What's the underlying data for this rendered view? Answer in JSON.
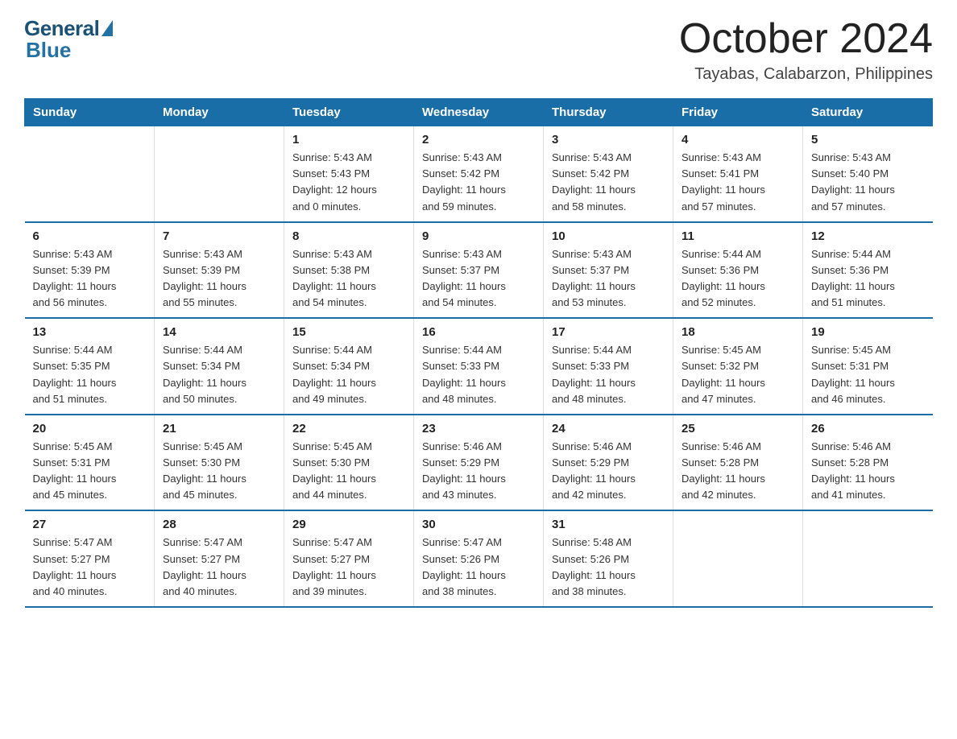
{
  "header": {
    "logo_general": "General",
    "logo_blue": "Blue",
    "month_title": "October 2024",
    "location": "Tayabas, Calabarzon, Philippines"
  },
  "weekdays": [
    "Sunday",
    "Monday",
    "Tuesday",
    "Wednesday",
    "Thursday",
    "Friday",
    "Saturday"
  ],
  "weeks": [
    [
      {
        "day": "",
        "info": ""
      },
      {
        "day": "",
        "info": ""
      },
      {
        "day": "1",
        "info": "Sunrise: 5:43 AM\nSunset: 5:43 PM\nDaylight: 12 hours\nand 0 minutes."
      },
      {
        "day": "2",
        "info": "Sunrise: 5:43 AM\nSunset: 5:42 PM\nDaylight: 11 hours\nand 59 minutes."
      },
      {
        "day": "3",
        "info": "Sunrise: 5:43 AM\nSunset: 5:42 PM\nDaylight: 11 hours\nand 58 minutes."
      },
      {
        "day": "4",
        "info": "Sunrise: 5:43 AM\nSunset: 5:41 PM\nDaylight: 11 hours\nand 57 minutes."
      },
      {
        "day": "5",
        "info": "Sunrise: 5:43 AM\nSunset: 5:40 PM\nDaylight: 11 hours\nand 57 minutes."
      }
    ],
    [
      {
        "day": "6",
        "info": "Sunrise: 5:43 AM\nSunset: 5:39 PM\nDaylight: 11 hours\nand 56 minutes."
      },
      {
        "day": "7",
        "info": "Sunrise: 5:43 AM\nSunset: 5:39 PM\nDaylight: 11 hours\nand 55 minutes."
      },
      {
        "day": "8",
        "info": "Sunrise: 5:43 AM\nSunset: 5:38 PM\nDaylight: 11 hours\nand 54 minutes."
      },
      {
        "day": "9",
        "info": "Sunrise: 5:43 AM\nSunset: 5:37 PM\nDaylight: 11 hours\nand 54 minutes."
      },
      {
        "day": "10",
        "info": "Sunrise: 5:43 AM\nSunset: 5:37 PM\nDaylight: 11 hours\nand 53 minutes."
      },
      {
        "day": "11",
        "info": "Sunrise: 5:44 AM\nSunset: 5:36 PM\nDaylight: 11 hours\nand 52 minutes."
      },
      {
        "day": "12",
        "info": "Sunrise: 5:44 AM\nSunset: 5:36 PM\nDaylight: 11 hours\nand 51 minutes."
      }
    ],
    [
      {
        "day": "13",
        "info": "Sunrise: 5:44 AM\nSunset: 5:35 PM\nDaylight: 11 hours\nand 51 minutes."
      },
      {
        "day": "14",
        "info": "Sunrise: 5:44 AM\nSunset: 5:34 PM\nDaylight: 11 hours\nand 50 minutes."
      },
      {
        "day": "15",
        "info": "Sunrise: 5:44 AM\nSunset: 5:34 PM\nDaylight: 11 hours\nand 49 minutes."
      },
      {
        "day": "16",
        "info": "Sunrise: 5:44 AM\nSunset: 5:33 PM\nDaylight: 11 hours\nand 48 minutes."
      },
      {
        "day": "17",
        "info": "Sunrise: 5:44 AM\nSunset: 5:33 PM\nDaylight: 11 hours\nand 48 minutes."
      },
      {
        "day": "18",
        "info": "Sunrise: 5:45 AM\nSunset: 5:32 PM\nDaylight: 11 hours\nand 47 minutes."
      },
      {
        "day": "19",
        "info": "Sunrise: 5:45 AM\nSunset: 5:31 PM\nDaylight: 11 hours\nand 46 minutes."
      }
    ],
    [
      {
        "day": "20",
        "info": "Sunrise: 5:45 AM\nSunset: 5:31 PM\nDaylight: 11 hours\nand 45 minutes."
      },
      {
        "day": "21",
        "info": "Sunrise: 5:45 AM\nSunset: 5:30 PM\nDaylight: 11 hours\nand 45 minutes."
      },
      {
        "day": "22",
        "info": "Sunrise: 5:45 AM\nSunset: 5:30 PM\nDaylight: 11 hours\nand 44 minutes."
      },
      {
        "day": "23",
        "info": "Sunrise: 5:46 AM\nSunset: 5:29 PM\nDaylight: 11 hours\nand 43 minutes."
      },
      {
        "day": "24",
        "info": "Sunrise: 5:46 AM\nSunset: 5:29 PM\nDaylight: 11 hours\nand 42 minutes."
      },
      {
        "day": "25",
        "info": "Sunrise: 5:46 AM\nSunset: 5:28 PM\nDaylight: 11 hours\nand 42 minutes."
      },
      {
        "day": "26",
        "info": "Sunrise: 5:46 AM\nSunset: 5:28 PM\nDaylight: 11 hours\nand 41 minutes."
      }
    ],
    [
      {
        "day": "27",
        "info": "Sunrise: 5:47 AM\nSunset: 5:27 PM\nDaylight: 11 hours\nand 40 minutes."
      },
      {
        "day": "28",
        "info": "Sunrise: 5:47 AM\nSunset: 5:27 PM\nDaylight: 11 hours\nand 40 minutes."
      },
      {
        "day": "29",
        "info": "Sunrise: 5:47 AM\nSunset: 5:27 PM\nDaylight: 11 hours\nand 39 minutes."
      },
      {
        "day": "30",
        "info": "Sunrise: 5:47 AM\nSunset: 5:26 PM\nDaylight: 11 hours\nand 38 minutes."
      },
      {
        "day": "31",
        "info": "Sunrise: 5:48 AM\nSunset: 5:26 PM\nDaylight: 11 hours\nand 38 minutes."
      },
      {
        "day": "",
        "info": ""
      },
      {
        "day": "",
        "info": ""
      }
    ]
  ]
}
